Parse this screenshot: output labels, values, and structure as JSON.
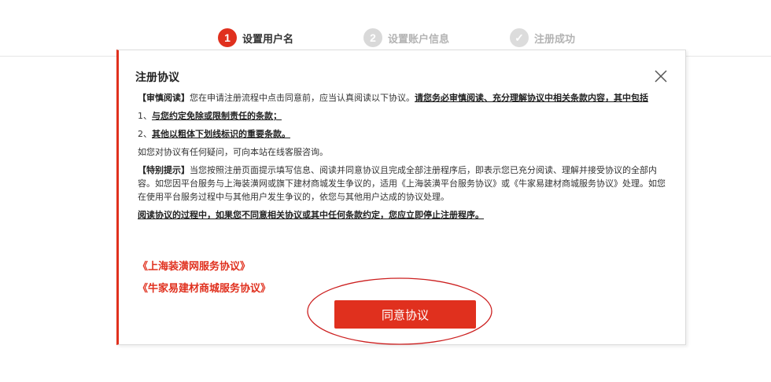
{
  "steps": [
    {
      "number": "1",
      "label": "设置用户名",
      "state": "active"
    },
    {
      "number": "2",
      "label": "设置账户信息",
      "state": "inactive"
    },
    {
      "number": "✓",
      "label": "注册成功",
      "state": "done"
    }
  ],
  "modal": {
    "title": "注册协议",
    "close_icon": "close-icon",
    "paragraphs": {
      "p1_bold": "【审慎阅读】",
      "p1_text": "您在申请注册流程中点击同意前，应当认真阅读以下协议。",
      "p1_bold_underline": "请您务必审慎阅读、充分理解协议中相关条款内容，其中包括",
      "p2_prefix": "1、",
      "p2_text": "与您约定免除或限制责任的条款；",
      "p3_prefix": "2、",
      "p3_text": "其他以粗体下划线标识的重要条款。",
      "p4_text": "如您对协议有任何疑问，可向本站在线客服咨询。",
      "p5_bold": "【特别提示】",
      "p5_text": "当您按照注册页面提示填写信息、阅读并同意协议且完成全部注册程序后，即表示您已充分阅读、理解并接受协议的全部内容。如您因平台服务与上海装潢网或旗下建材商城发生争议的，适用《上海装潢平台服务协议》或《牛家易建材商城服务协议》处理。如您在使用平台服务过程中与其他用户发生争议的，依您与其他用户达成的协议处理。",
      "p6_text": "阅读协议的过程中，如果您不同意相关协议或其中任何条款约定，您应立即停止注册程序。"
    },
    "links": {
      "link1": "《上海装潢网服务协议》",
      "link2": "《牛家易建材商城服务协议》"
    },
    "agree_button": "同意协议"
  },
  "colors": {
    "accent": "#e0301e",
    "inactive": "#d9d9d9"
  }
}
